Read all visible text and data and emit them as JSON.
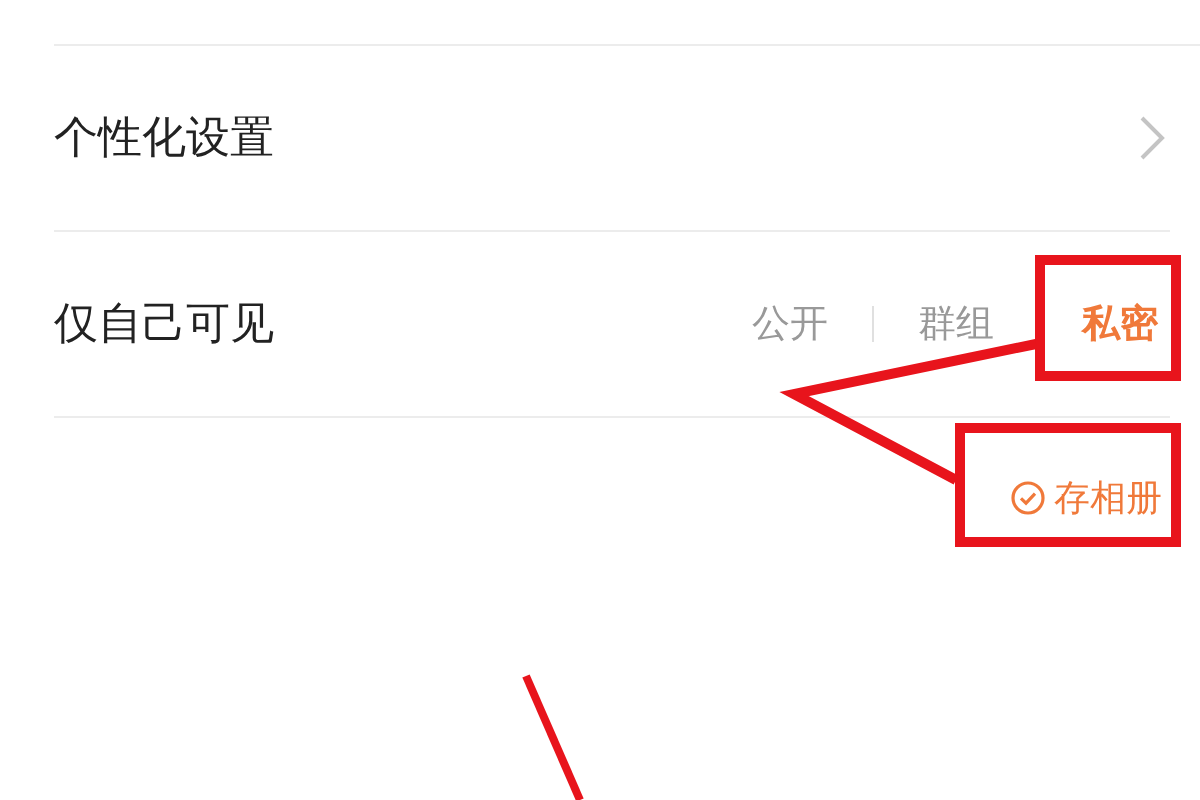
{
  "rows": [
    {
      "kind": "link",
      "label": "个性化设置"
    },
    {
      "kind": "segmented",
      "label": "仅自己可见",
      "options": [
        {
          "label": "公开",
          "selected": false
        },
        {
          "label": "群组",
          "selected": false
        },
        {
          "label": "私密",
          "selected": true
        }
      ]
    }
  ],
  "save_option": {
    "label": "存相册",
    "checked": true
  }
}
